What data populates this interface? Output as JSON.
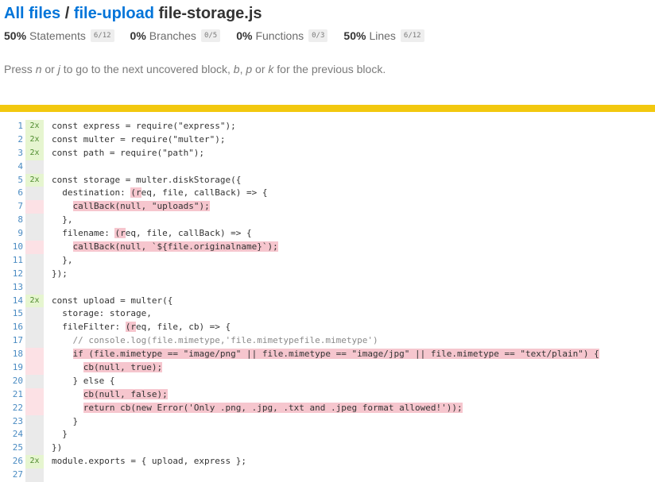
{
  "breadcrumb": {
    "all_files": "All files",
    "sep": " / ",
    "folder": "file-upload",
    "file": "file-storage.js"
  },
  "summary": [
    {
      "pct": "50%",
      "label": "Statements",
      "frac": "6/12"
    },
    {
      "pct": "0%",
      "label": "Branches",
      "frac": "0/5"
    },
    {
      "pct": "0%",
      "label": "Functions",
      "frac": "0/3"
    },
    {
      "pct": "50%",
      "label": "Lines",
      "frac": "6/12"
    }
  ],
  "hint": {
    "a": "Press ",
    "n": "n",
    "b": " or ",
    "j": "j",
    "c": " to go to the next uncovered block, ",
    "bk": "b",
    "d": ", ",
    "p": "p",
    "e": " or ",
    "k": "k",
    "f": " for the previous block."
  },
  "colors": {
    "status_bar": "#f2c80f",
    "hit": "#e6f5d0",
    "miss": "#f6c6ce",
    "link": "#0074d9"
  },
  "lines": [
    {
      "n": "1",
      "count": "2x",
      "cov": "hit",
      "code": "const express = require(\"express\");"
    },
    {
      "n": "2",
      "count": "2x",
      "cov": "hit",
      "code": "const multer = require(\"multer\");"
    },
    {
      "n": "3",
      "count": "2x",
      "cov": "hit",
      "code": "const path = require(\"path\");"
    },
    {
      "n": "4",
      "count": "",
      "cov": "neutral",
      "code": ""
    },
    {
      "n": "5",
      "count": "2x",
      "cov": "hit",
      "code": "const storage = multer.diskStorage({"
    },
    {
      "n": "6",
      "count": "",
      "cov": "neutral",
      "code": "  destination: ",
      "fn": "(r",
      "rest": "eq, file, callBack) => {"
    },
    {
      "n": "7",
      "count": "",
      "cov": "miss",
      "code": "    callBack(null, \"uploads\");"
    },
    {
      "n": "8",
      "count": "",
      "cov": "neutral",
      "code": "  },"
    },
    {
      "n": "9",
      "count": "",
      "cov": "neutral",
      "code": "  filename: ",
      "fn": "(r",
      "rest": "eq, file, callBack) => {"
    },
    {
      "n": "10",
      "count": "",
      "cov": "miss",
      "code": "    callBack(null, `${file.originalname}`);"
    },
    {
      "n": "11",
      "count": "",
      "cov": "neutral",
      "code": "  },"
    },
    {
      "n": "12",
      "count": "",
      "cov": "neutral",
      "code": "});"
    },
    {
      "n": "13",
      "count": "",
      "cov": "neutral",
      "code": ""
    },
    {
      "n": "14",
      "count": "2x",
      "cov": "hit",
      "code": "const upload = multer({"
    },
    {
      "n": "15",
      "count": "",
      "cov": "neutral",
      "code": "  storage: storage,"
    },
    {
      "n": "16",
      "count": "",
      "cov": "neutral",
      "code": "  fileFilter: ",
      "fn": "(r",
      "rest": "eq, file, cb) => {"
    },
    {
      "n": "17",
      "count": "",
      "cov": "neutral",
      "code": "    // console.log(file.mimetype,'file.mimetypefile.mimetype')",
      "comment": true
    },
    {
      "n": "18",
      "count": "",
      "cov": "miss",
      "code": "    if (file.mimetype == \"image/png\" || file.mimetype == \"image/jpg\" || file.mimetype == \"text/plain\") {"
    },
    {
      "n": "19",
      "count": "",
      "cov": "miss",
      "code": "      cb(null, true);"
    },
    {
      "n": "20",
      "count": "",
      "cov": "neutral",
      "code": "    } else {"
    },
    {
      "n": "21",
      "count": "",
      "cov": "miss",
      "code": "      cb(null, false);"
    },
    {
      "n": "22",
      "count": "",
      "cov": "miss",
      "code": "      return cb(new Error('Only .png, .jpg, .txt and .jpeg format allowed!'));"
    },
    {
      "n": "23",
      "count": "",
      "cov": "neutral",
      "code": "    }"
    },
    {
      "n": "24",
      "count": "",
      "cov": "neutral",
      "code": "  }"
    },
    {
      "n": "25",
      "count": "",
      "cov": "neutral",
      "code": "})"
    },
    {
      "n": "26",
      "count": "2x",
      "cov": "hit",
      "code": "module.exports = { upload, express };"
    },
    {
      "n": "27",
      "count": "",
      "cov": "neutral",
      "code": ""
    }
  ]
}
